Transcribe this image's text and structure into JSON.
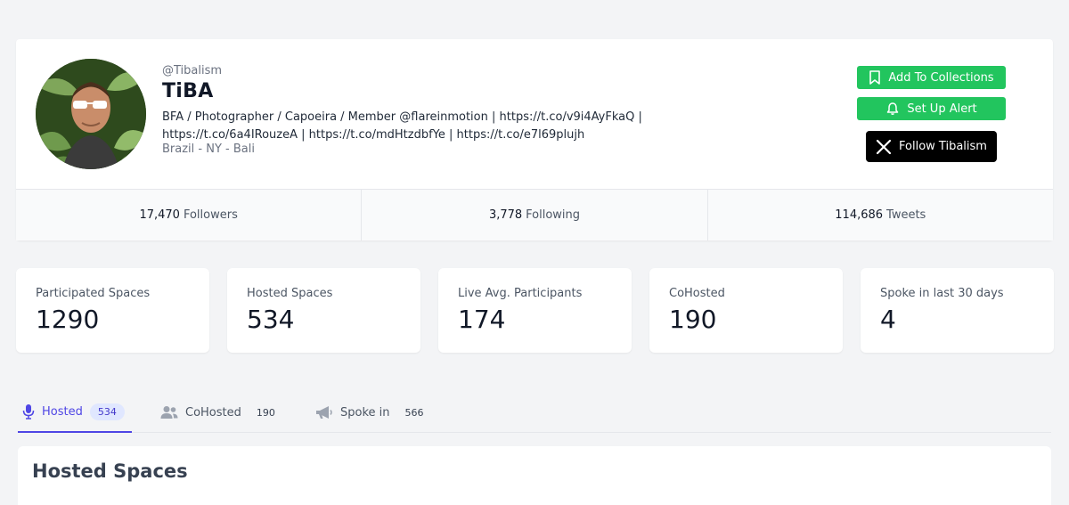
{
  "profile": {
    "handle": "@Tibalism",
    "name": "TiBA",
    "bio": "BFA / Photographer / Capoeira / Member @flareinmotion | https://t.co/v9i4AyFkaQ | https://t.co/6a4IRouzeA | https://t.co/mdHtzdbfYe | https://t.co/e7l69plujh",
    "location": "Brazil - NY - Bali"
  },
  "actions": {
    "add_collections": "Add To Collections",
    "set_alert": "Set Up Alert",
    "follow": "Follow Tibalism"
  },
  "stats": [
    {
      "value": "17,470",
      "label": "Followers"
    },
    {
      "value": "3,778",
      "label": "Following"
    },
    {
      "value": "114,686",
      "label": "Tweets"
    }
  ],
  "metrics": [
    {
      "label": "Participated Spaces",
      "value": "1290"
    },
    {
      "label": "Hosted Spaces",
      "value": "534"
    },
    {
      "label": "Live Avg. Participants",
      "value": "174"
    },
    {
      "label": "CoHosted",
      "value": "190"
    },
    {
      "label": "Spoke in last 30 days",
      "value": "4"
    }
  ],
  "tabs": [
    {
      "label": "Hosted",
      "count": "534",
      "icon": "microphone-icon",
      "active": true
    },
    {
      "label": "CoHosted",
      "count": "190",
      "icon": "users-icon",
      "active": false
    },
    {
      "label": "Spoke in",
      "count": "566",
      "icon": "megaphone-icon",
      "active": false
    }
  ],
  "section": {
    "title": "Hosted Spaces"
  },
  "colors": {
    "accent": "#4f46e5",
    "green": "#22c55e",
    "follow_bg": "#000000"
  }
}
